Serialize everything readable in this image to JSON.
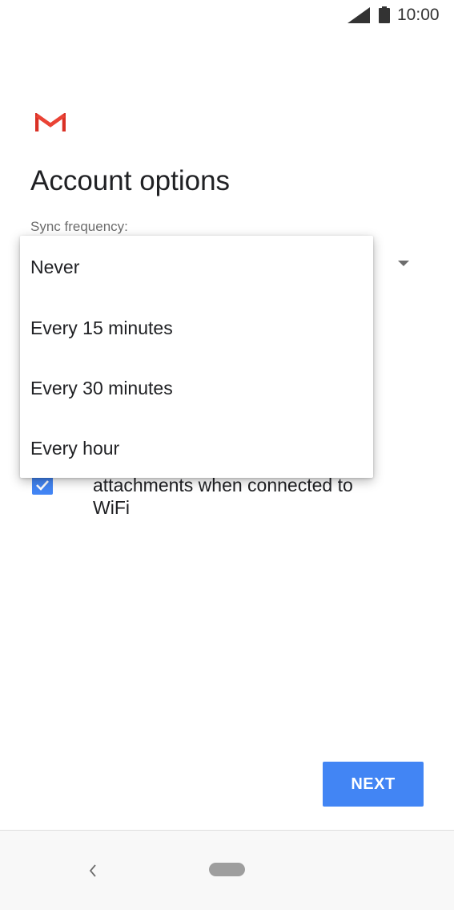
{
  "status_bar": {
    "time": "10:00",
    "icons": [
      "signal-icon",
      "battery-icon"
    ]
  },
  "app": {
    "logo": "gmail-logo",
    "logo_colors": [
      "#d93025",
      "#ea4335",
      "#c5221f"
    ]
  },
  "page": {
    "title": "Account options",
    "sync_label": "Sync frequency:"
  },
  "sync_menu": {
    "options": [
      "Never",
      "Every 15 minutes",
      "Every 30 minutes",
      "Every hour"
    ]
  },
  "wifi_option": {
    "checked": true,
    "text_line1": "attachments when connected to",
    "text_line2": "WiFi"
  },
  "footer": {
    "next_label": "NEXT"
  },
  "nav_bar": {
    "icons": [
      "back-icon",
      "home-pill"
    ]
  },
  "colors": {
    "accent": "#4285f4",
    "title_text": "#202124",
    "label_text": "#6d6d6d"
  }
}
